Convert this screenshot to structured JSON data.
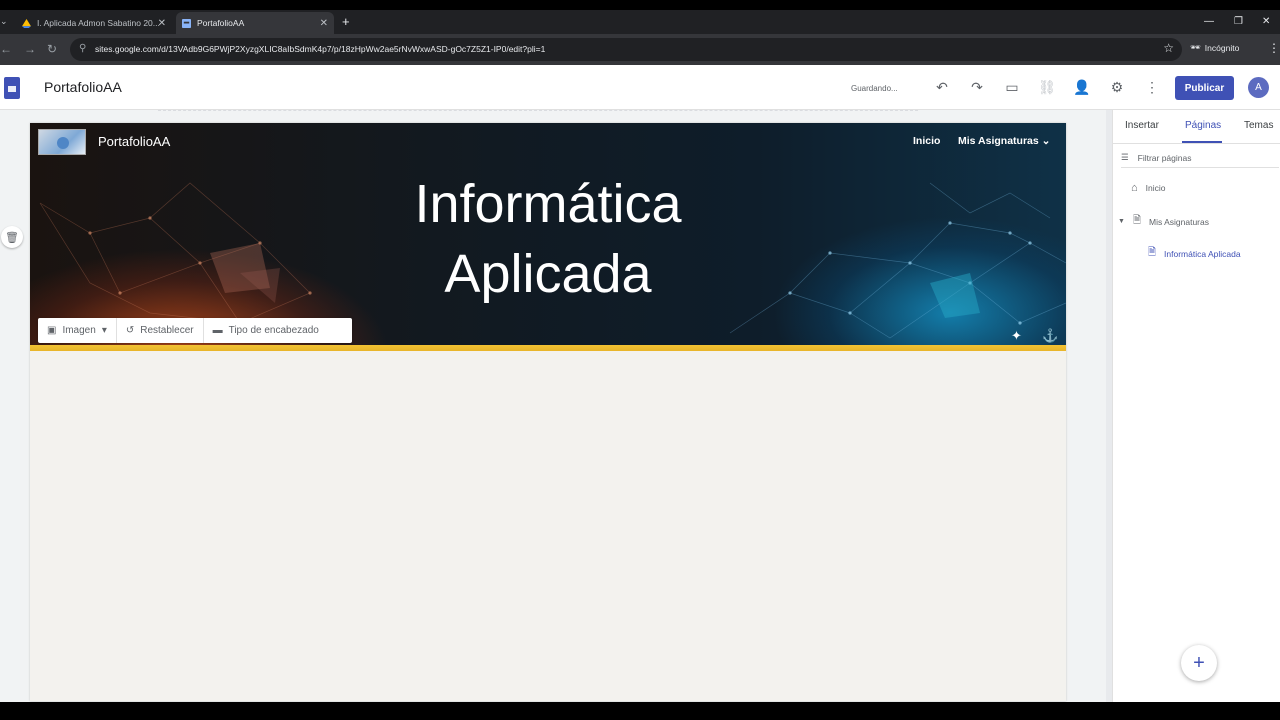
{
  "browser": {
    "tabs": [
      {
        "label": "I. Aplicada Admon Sabatino 20...",
        "active": false
      },
      {
        "label": "PortafolioAA",
        "active": true
      }
    ],
    "url": "sites.google.com/d/13VAdb9G6PWjP2XyzgXLIC8aIbSdmK4p7/p/18zHpWw2ae5rNvWxwASD-gOc7Z5Z1-IP0/edit?pli=1",
    "incognito_label": "Incógnito"
  },
  "app": {
    "title": "PortafolioAA",
    "status": "Guardando...",
    "publish_label": "Publicar",
    "avatar_initial": "A",
    "accent_color": "#3f51b5"
  },
  "site": {
    "name": "PortafolioAA",
    "nav": {
      "home": "Inicio",
      "subjects": "Mis Asignaturas"
    },
    "hero_title_line1": "Informática",
    "hero_title_line2": "Aplicada",
    "toolbar": {
      "image": "Imagen",
      "reset": "Restablecer",
      "header_type": "Tipo de encabezado"
    }
  },
  "panel": {
    "tabs": {
      "insert": "Insertar",
      "pages": "Páginas",
      "themes": "Temas"
    },
    "filter_placeholder": "Filtrar páginas",
    "pages": [
      {
        "label": "Inicio",
        "icon": "home-icon"
      },
      {
        "label": "Mis Asignaturas",
        "icon": "page-icon"
      },
      {
        "label": "Informática Aplicada",
        "icon": "page-icon",
        "active": true
      }
    ]
  }
}
